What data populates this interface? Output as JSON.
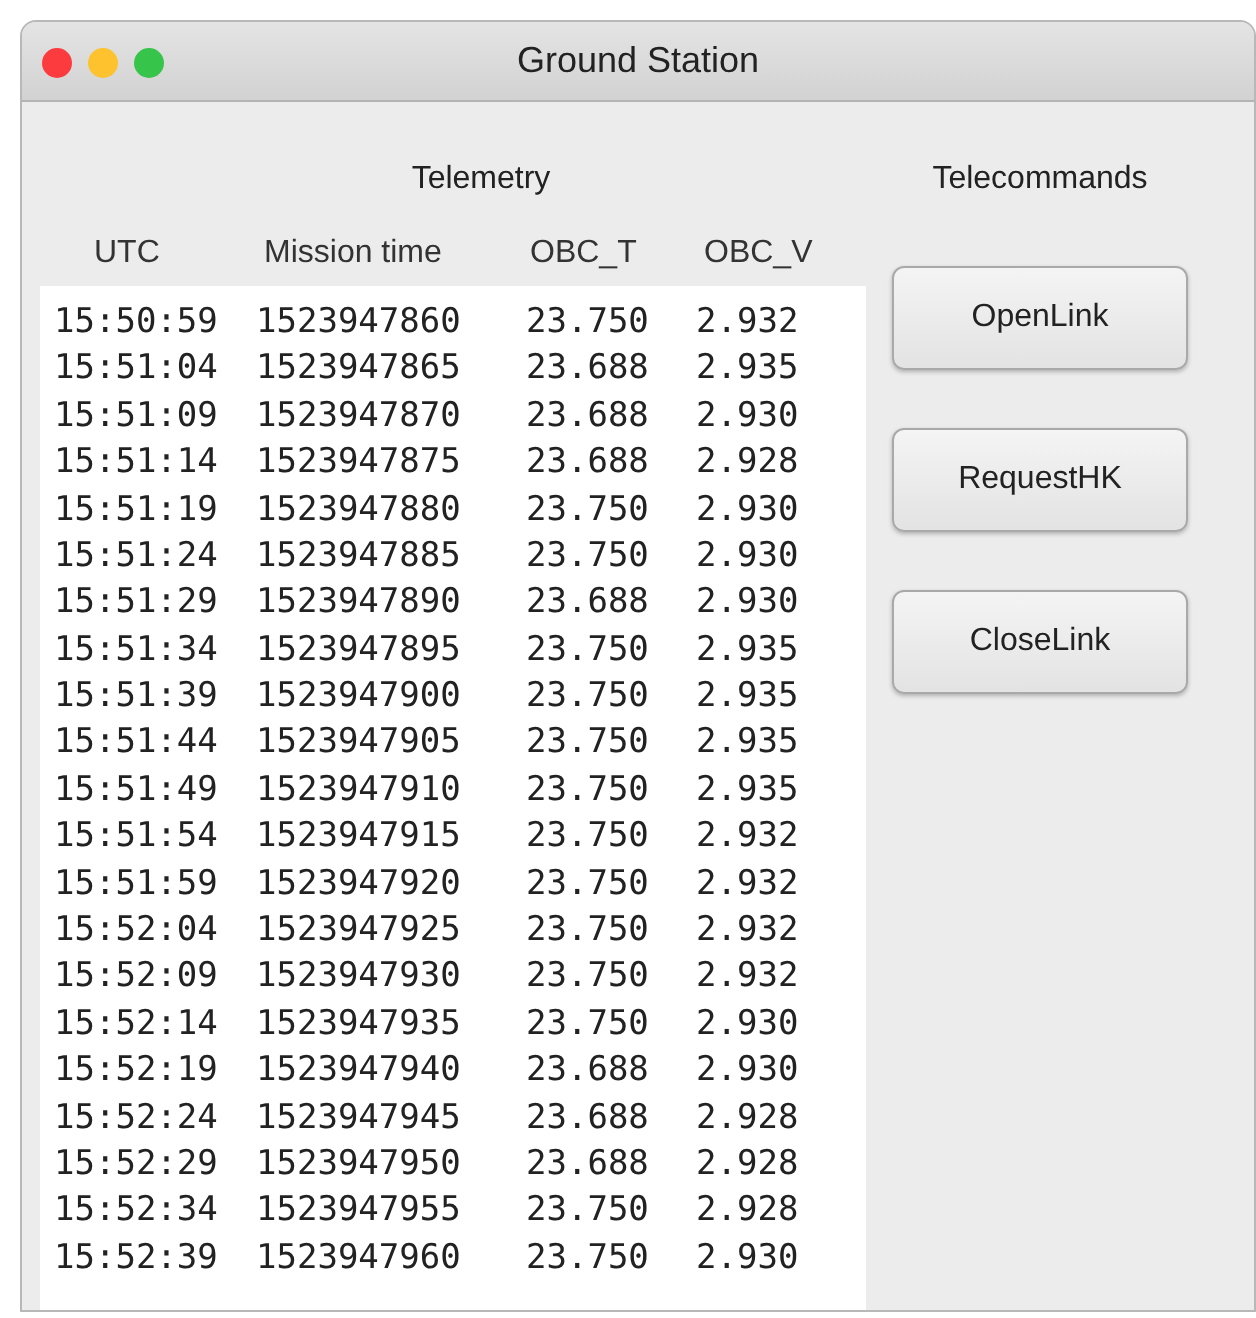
{
  "window": {
    "title": "Ground Station"
  },
  "telemetry": {
    "title": "Telemetry",
    "columns": [
      "UTC",
      "Mission time",
      "OBC_T",
      "OBC_V"
    ],
    "rows": [
      [
        "15:50:59",
        "1523947860",
        "23.750",
        "2.932"
      ],
      [
        "15:51:04",
        "1523947865",
        "23.688",
        "2.935"
      ],
      [
        "15:51:09",
        "1523947870",
        "23.688",
        "2.930"
      ],
      [
        "15:51:14",
        "1523947875",
        "23.688",
        "2.928"
      ],
      [
        "15:51:19",
        "1523947880",
        "23.750",
        "2.930"
      ],
      [
        "15:51:24",
        "1523947885",
        "23.750",
        "2.930"
      ],
      [
        "15:51:29",
        "1523947890",
        "23.688",
        "2.930"
      ],
      [
        "15:51:34",
        "1523947895",
        "23.750",
        "2.935"
      ],
      [
        "15:51:39",
        "1523947900",
        "23.750",
        "2.935"
      ],
      [
        "15:51:44",
        "1523947905",
        "23.750",
        "2.935"
      ],
      [
        "15:51:49",
        "1523947910",
        "23.750",
        "2.935"
      ],
      [
        "15:51:54",
        "1523947915",
        "23.750",
        "2.932"
      ],
      [
        "15:51:59",
        "1523947920",
        "23.750",
        "2.932"
      ],
      [
        "15:52:04",
        "1523947925",
        "23.750",
        "2.932"
      ],
      [
        "15:52:09",
        "1523947930",
        "23.750",
        "2.932"
      ],
      [
        "15:52:14",
        "1523947935",
        "23.750",
        "2.930"
      ],
      [
        "15:52:19",
        "1523947940",
        "23.688",
        "2.930"
      ],
      [
        "15:52:24",
        "1523947945",
        "23.688",
        "2.928"
      ],
      [
        "15:52:29",
        "1523947950",
        "23.688",
        "2.928"
      ],
      [
        "15:52:34",
        "1523947955",
        "23.750",
        "2.928"
      ],
      [
        "15:52:39",
        "1523947960",
        "23.750",
        "2.930"
      ]
    ]
  },
  "telecommands": {
    "title": "Telecommands",
    "buttons": [
      "OpenLink",
      "RequestHK",
      "CloseLink"
    ]
  }
}
